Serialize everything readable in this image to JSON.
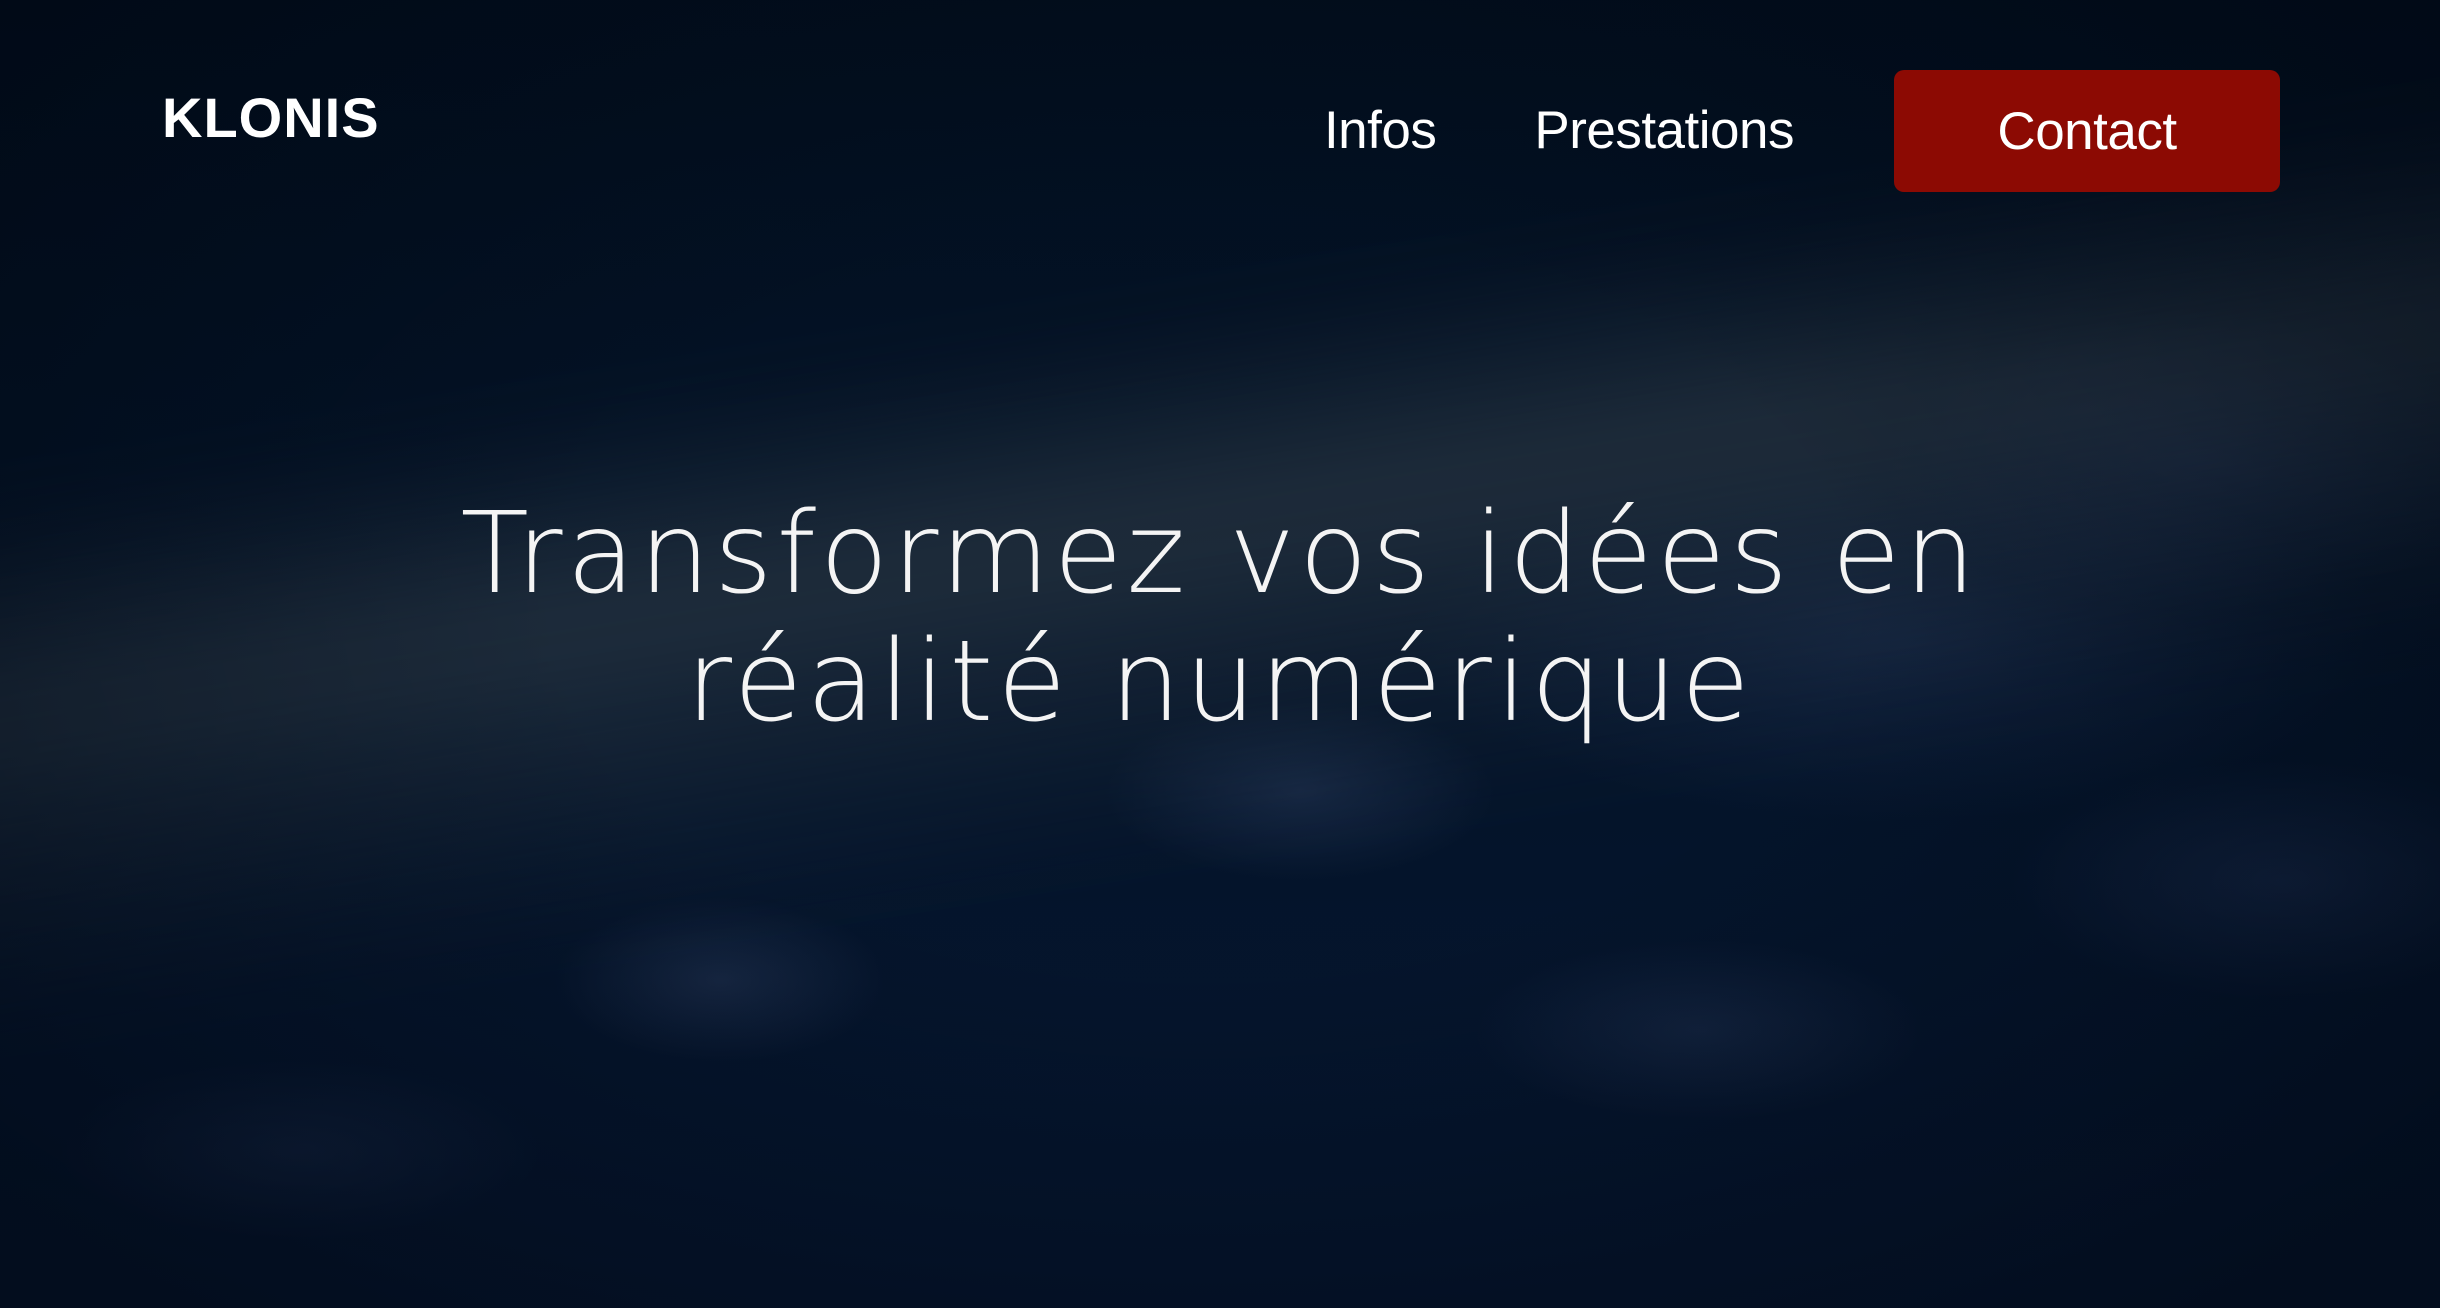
{
  "brand": {
    "name": "KLONIS"
  },
  "nav": {
    "items": [
      {
        "label": "Infos"
      },
      {
        "label": "Prestations"
      }
    ],
    "contact_label": "Contact"
  },
  "hero": {
    "title_line_1": "Transformez vos idées en",
    "title_line_2": "réalité numérique"
  },
  "colors": {
    "background": "#031020",
    "accent": "#8c0a03",
    "text": "#ffffff"
  }
}
